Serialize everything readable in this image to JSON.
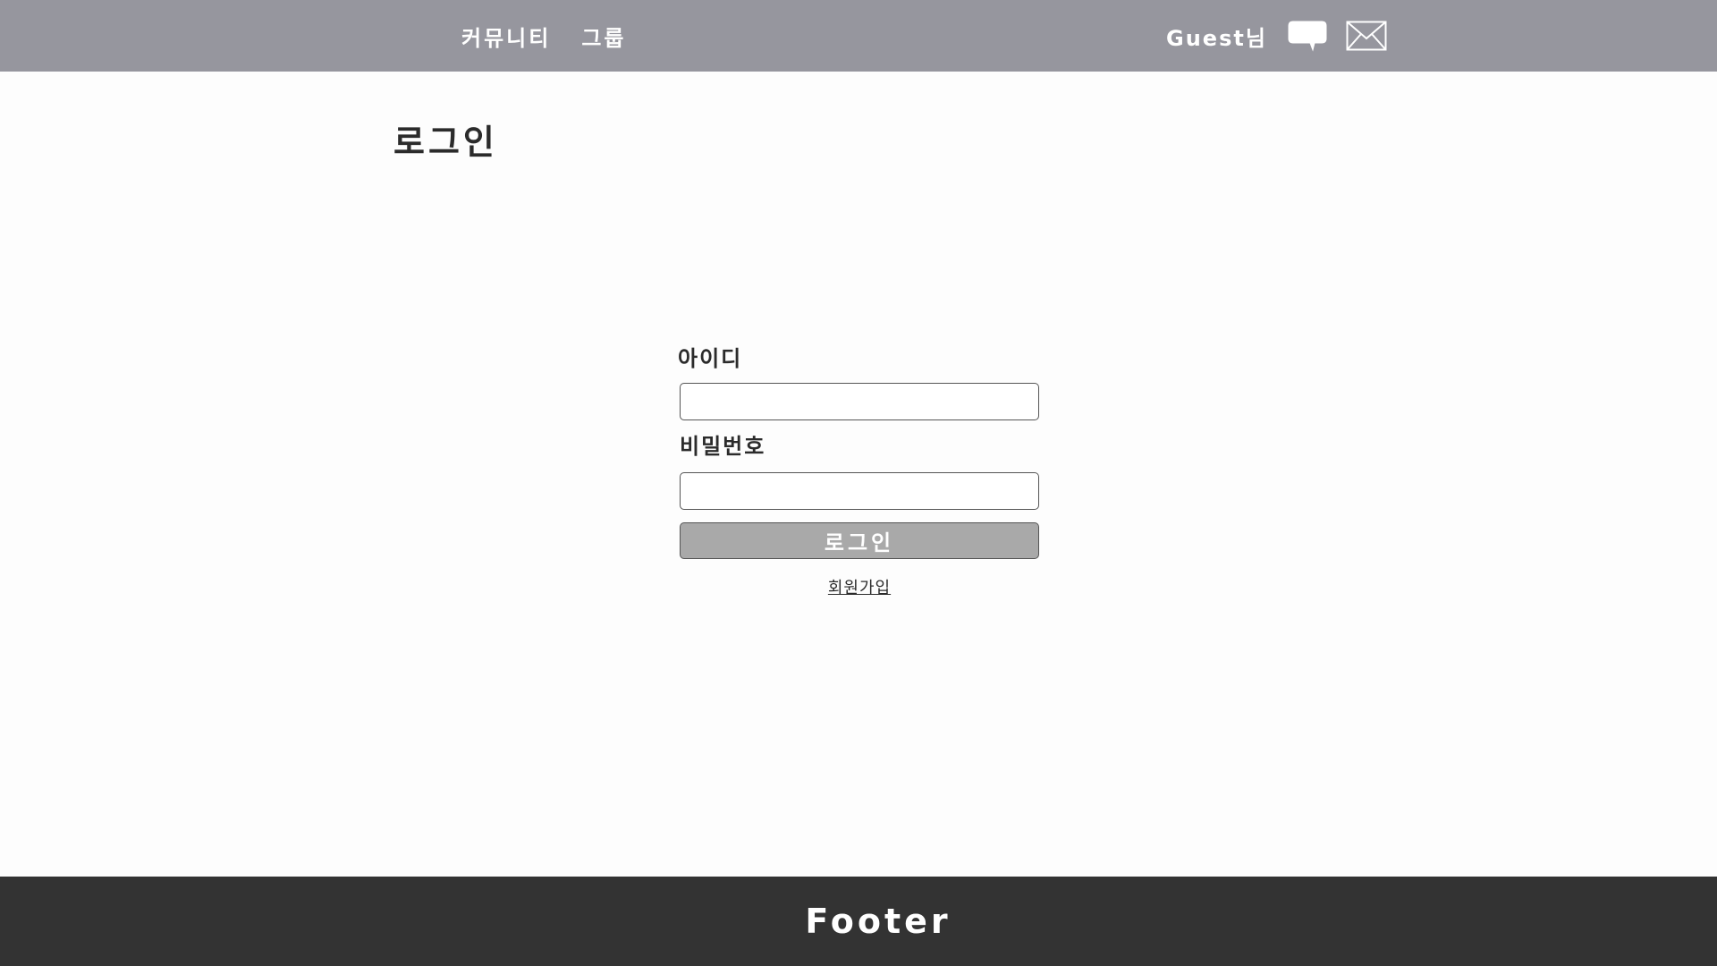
{
  "header": {
    "nav": [
      {
        "label": "커뮤니티"
      },
      {
        "label": "그룹"
      }
    ],
    "user_label": "Guest님",
    "icons": {
      "chat": "speech-bubble-icon",
      "mail": "envelope-icon"
    }
  },
  "page": {
    "title": "로그인"
  },
  "form": {
    "id_label": "아이디",
    "id_value": "",
    "password_label": "비밀번호",
    "password_value": "",
    "submit_label": "로그인",
    "signup_link": "회원가입"
  },
  "footer": {
    "text": "Footer"
  },
  "colors": {
    "header_bg": "#96969e",
    "footer_bg": "#333333",
    "button_bg": "#a9a9a9",
    "page_bg": "#fdfdfd"
  }
}
